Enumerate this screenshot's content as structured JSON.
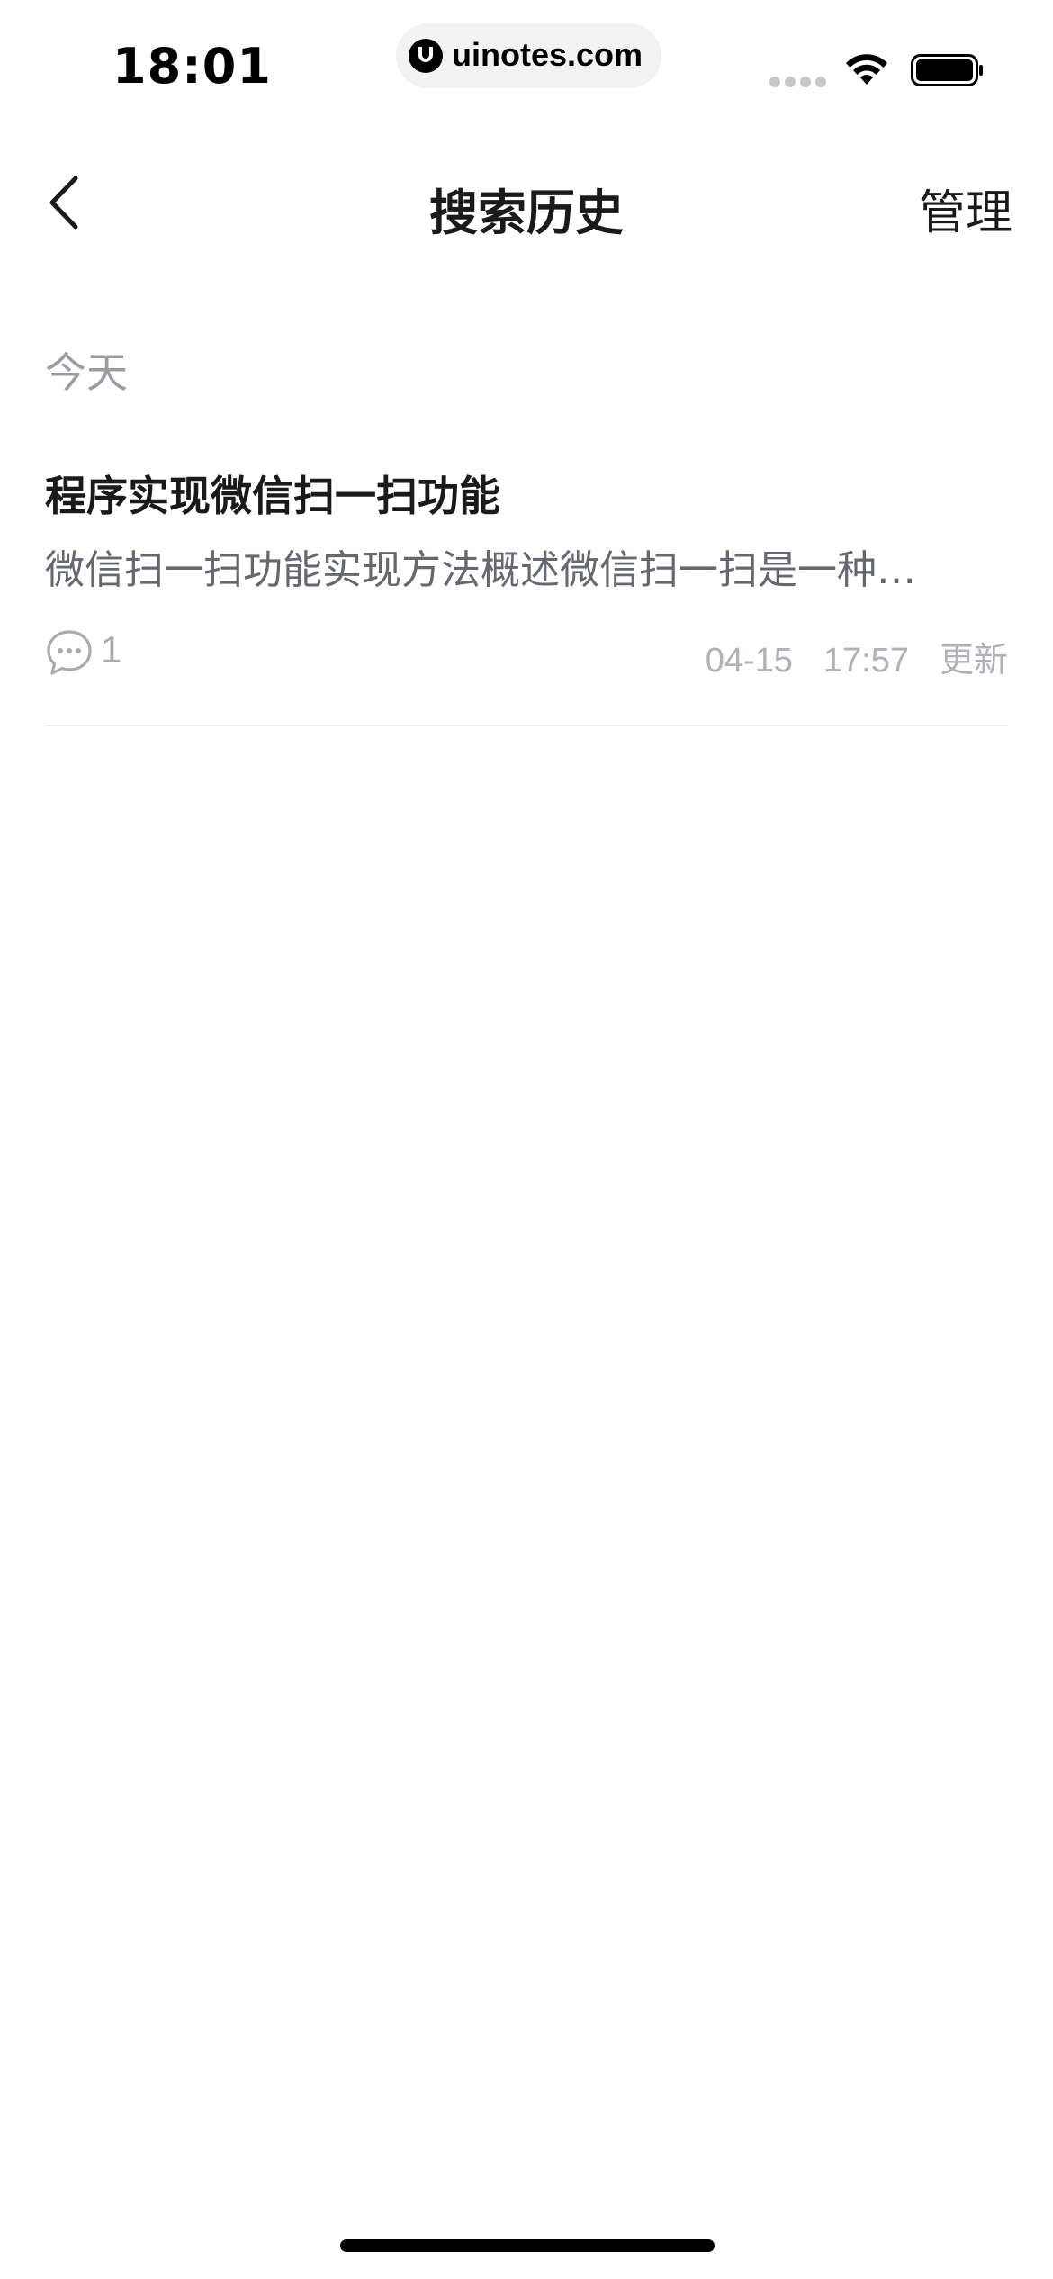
{
  "status_bar": {
    "time": "18:01",
    "url": "uinotes.com"
  },
  "nav": {
    "title": "搜索历史",
    "manage_label": "管理"
  },
  "section": {
    "header": "今天"
  },
  "history_items": [
    {
      "title": "程序实现微信扫一扫功能",
      "snippet": "微信扫一扫功能实现方法概述微信扫一扫是一种…",
      "comment_count": "1",
      "date": "04-15",
      "time": "17:57",
      "status": "更新"
    }
  ]
}
